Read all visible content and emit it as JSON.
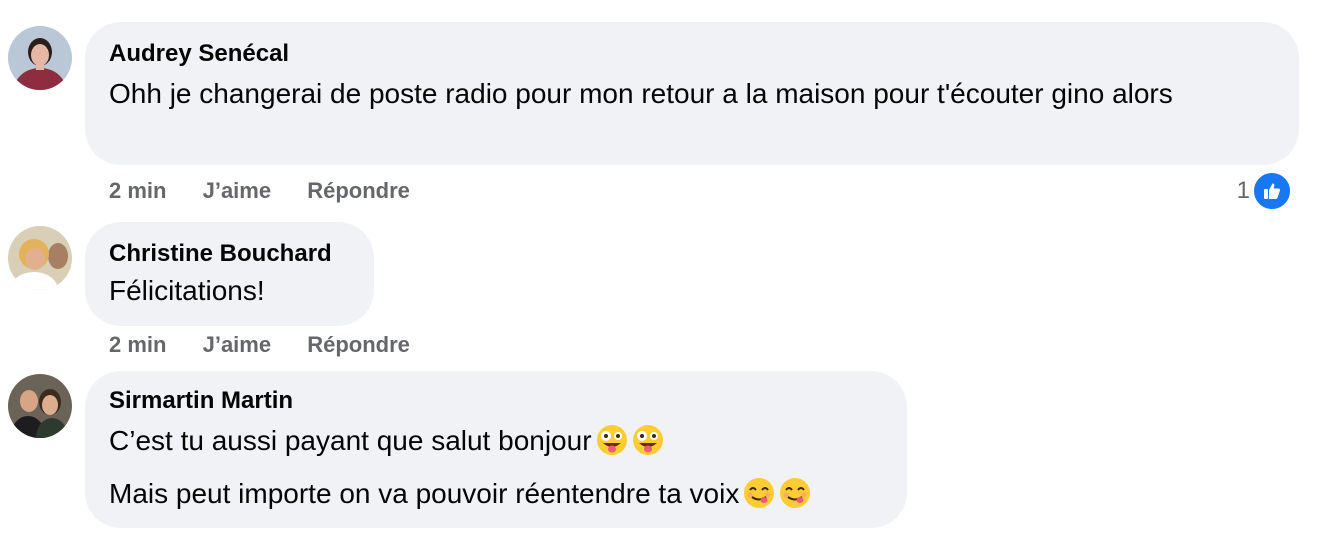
{
  "comments": [
    {
      "author": "Audrey Senécal",
      "lines": [
        "Ohh je changerai de poste radio pour mon retour a la maison pour t'écouter gino alors"
      ],
      "time": "2 min",
      "like_label": "J’aime",
      "reply_label": "Répondre",
      "reaction_count": "1",
      "reaction_icon": "like-icon",
      "avatar_colors": {
        "bg": "#b9c7d6",
        "shirt": "#8e2d3f",
        "skin": "#e4b8a4",
        "hair": "#2b1f1c"
      }
    },
    {
      "author": "Christine Bouchard",
      "lines": [
        "Félicitations!"
      ],
      "time": "2 min",
      "like_label": "J’aime",
      "reply_label": "Répondre",
      "avatar_colors": {
        "bg": "#d8cfb6",
        "shirt": "#ffffff",
        "skin": "#e2b08e",
        "hair": "#e3b25a"
      }
    },
    {
      "author": "Sirmartin Martin",
      "lines": [
        "C’est tu aussi payant que salut bonjour",
        "Mais peut importe on va pouvoir réentendre ta voix"
      ],
      "line_emojis": [
        [
          "zany-face-emoji",
          "zany-face-emoji"
        ],
        [
          "yum-face-emoji",
          "yum-face-emoji"
        ]
      ],
      "avatar_colors": {
        "bg": "#6b6258",
        "shirt": "#1d1d1f",
        "skin": "#d7a586",
        "hair": "#3a2a20"
      }
    }
  ],
  "colors": {
    "bubble": "#f0f2f5",
    "meta_text": "#65676b",
    "like_blue": "#1877f2"
  }
}
